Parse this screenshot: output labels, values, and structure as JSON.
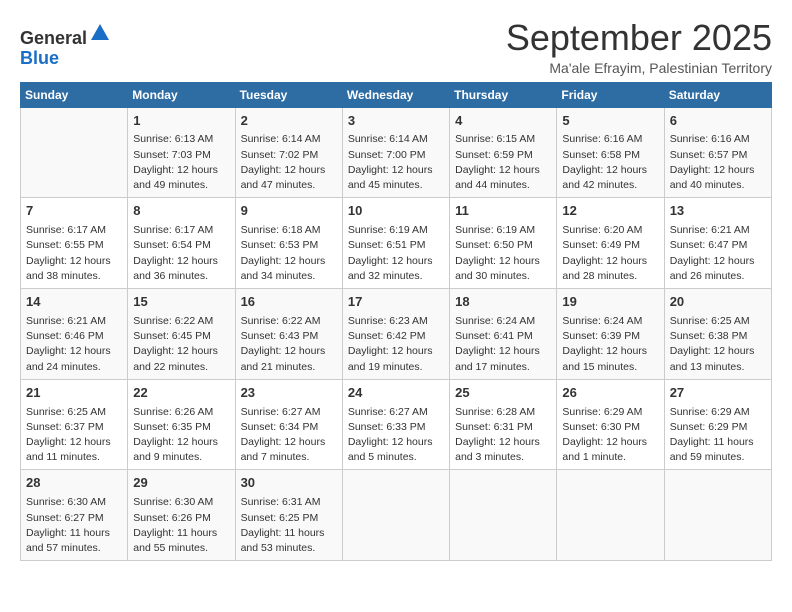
{
  "header": {
    "logo_line1": "General",
    "logo_line2": "Blue",
    "month_title": "September 2025",
    "location": "Ma'ale Efrayim, Palestinian Territory"
  },
  "days_of_week": [
    "Sunday",
    "Monday",
    "Tuesday",
    "Wednesday",
    "Thursday",
    "Friday",
    "Saturday"
  ],
  "weeks": [
    [
      {
        "day": "",
        "content": ""
      },
      {
        "day": "1",
        "content": "Sunrise: 6:13 AM\nSunset: 7:03 PM\nDaylight: 12 hours\nand 49 minutes."
      },
      {
        "day": "2",
        "content": "Sunrise: 6:14 AM\nSunset: 7:02 PM\nDaylight: 12 hours\nand 47 minutes."
      },
      {
        "day": "3",
        "content": "Sunrise: 6:14 AM\nSunset: 7:00 PM\nDaylight: 12 hours\nand 45 minutes."
      },
      {
        "day": "4",
        "content": "Sunrise: 6:15 AM\nSunset: 6:59 PM\nDaylight: 12 hours\nand 44 minutes."
      },
      {
        "day": "5",
        "content": "Sunrise: 6:16 AM\nSunset: 6:58 PM\nDaylight: 12 hours\nand 42 minutes."
      },
      {
        "day": "6",
        "content": "Sunrise: 6:16 AM\nSunset: 6:57 PM\nDaylight: 12 hours\nand 40 minutes."
      }
    ],
    [
      {
        "day": "7",
        "content": "Sunrise: 6:17 AM\nSunset: 6:55 PM\nDaylight: 12 hours\nand 38 minutes."
      },
      {
        "day": "8",
        "content": "Sunrise: 6:17 AM\nSunset: 6:54 PM\nDaylight: 12 hours\nand 36 minutes."
      },
      {
        "day": "9",
        "content": "Sunrise: 6:18 AM\nSunset: 6:53 PM\nDaylight: 12 hours\nand 34 minutes."
      },
      {
        "day": "10",
        "content": "Sunrise: 6:19 AM\nSunset: 6:51 PM\nDaylight: 12 hours\nand 32 minutes."
      },
      {
        "day": "11",
        "content": "Sunrise: 6:19 AM\nSunset: 6:50 PM\nDaylight: 12 hours\nand 30 minutes."
      },
      {
        "day": "12",
        "content": "Sunrise: 6:20 AM\nSunset: 6:49 PM\nDaylight: 12 hours\nand 28 minutes."
      },
      {
        "day": "13",
        "content": "Sunrise: 6:21 AM\nSunset: 6:47 PM\nDaylight: 12 hours\nand 26 minutes."
      }
    ],
    [
      {
        "day": "14",
        "content": "Sunrise: 6:21 AM\nSunset: 6:46 PM\nDaylight: 12 hours\nand 24 minutes."
      },
      {
        "day": "15",
        "content": "Sunrise: 6:22 AM\nSunset: 6:45 PM\nDaylight: 12 hours\nand 22 minutes."
      },
      {
        "day": "16",
        "content": "Sunrise: 6:22 AM\nSunset: 6:43 PM\nDaylight: 12 hours\nand 21 minutes."
      },
      {
        "day": "17",
        "content": "Sunrise: 6:23 AM\nSunset: 6:42 PM\nDaylight: 12 hours\nand 19 minutes."
      },
      {
        "day": "18",
        "content": "Sunrise: 6:24 AM\nSunset: 6:41 PM\nDaylight: 12 hours\nand 17 minutes."
      },
      {
        "day": "19",
        "content": "Sunrise: 6:24 AM\nSunset: 6:39 PM\nDaylight: 12 hours\nand 15 minutes."
      },
      {
        "day": "20",
        "content": "Sunrise: 6:25 AM\nSunset: 6:38 PM\nDaylight: 12 hours\nand 13 minutes."
      }
    ],
    [
      {
        "day": "21",
        "content": "Sunrise: 6:25 AM\nSunset: 6:37 PM\nDaylight: 12 hours\nand 11 minutes."
      },
      {
        "day": "22",
        "content": "Sunrise: 6:26 AM\nSunset: 6:35 PM\nDaylight: 12 hours\nand 9 minutes."
      },
      {
        "day": "23",
        "content": "Sunrise: 6:27 AM\nSunset: 6:34 PM\nDaylight: 12 hours\nand 7 minutes."
      },
      {
        "day": "24",
        "content": "Sunrise: 6:27 AM\nSunset: 6:33 PM\nDaylight: 12 hours\nand 5 minutes."
      },
      {
        "day": "25",
        "content": "Sunrise: 6:28 AM\nSunset: 6:31 PM\nDaylight: 12 hours\nand 3 minutes."
      },
      {
        "day": "26",
        "content": "Sunrise: 6:29 AM\nSunset: 6:30 PM\nDaylight: 12 hours\nand 1 minute."
      },
      {
        "day": "27",
        "content": "Sunrise: 6:29 AM\nSunset: 6:29 PM\nDaylight: 11 hours\nand 59 minutes."
      }
    ],
    [
      {
        "day": "28",
        "content": "Sunrise: 6:30 AM\nSunset: 6:27 PM\nDaylight: 11 hours\nand 57 minutes."
      },
      {
        "day": "29",
        "content": "Sunrise: 6:30 AM\nSunset: 6:26 PM\nDaylight: 11 hours\nand 55 minutes."
      },
      {
        "day": "30",
        "content": "Sunrise: 6:31 AM\nSunset: 6:25 PM\nDaylight: 11 hours\nand 53 minutes."
      },
      {
        "day": "",
        "content": ""
      },
      {
        "day": "",
        "content": ""
      },
      {
        "day": "",
        "content": ""
      },
      {
        "day": "",
        "content": ""
      }
    ]
  ]
}
